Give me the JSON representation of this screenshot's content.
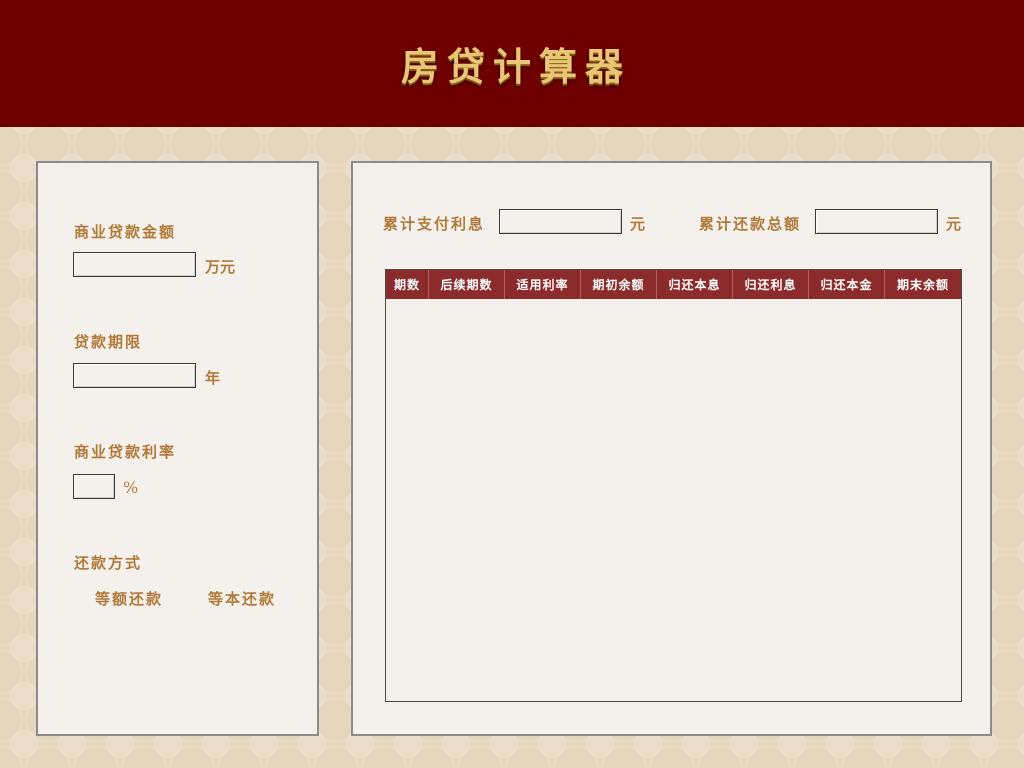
{
  "header": {
    "title": "房贷计算器"
  },
  "form": {
    "loan_amount": {
      "label": "商业贷款金额",
      "value": "",
      "unit": "万元"
    },
    "loan_term": {
      "label": "贷款期限",
      "value": "",
      "unit": "年"
    },
    "interest_rate": {
      "label": "商业贷款利率",
      "value": "",
      "unit": "%"
    },
    "repayment_method": {
      "label": "还款方式",
      "options": [
        "等额还款",
        "等本还款"
      ]
    }
  },
  "summary": {
    "total_interest": {
      "label": "累计支付利息",
      "value": "",
      "unit": "元"
    },
    "total_payment": {
      "label": "累计还款总额",
      "value": "",
      "unit": "元"
    }
  },
  "table": {
    "columns": [
      "期数",
      "后续期数",
      "适用利率",
      "期初余额",
      "归还本息",
      "归还利息",
      "归还本金",
      "期末余额"
    ],
    "rows": []
  }
}
